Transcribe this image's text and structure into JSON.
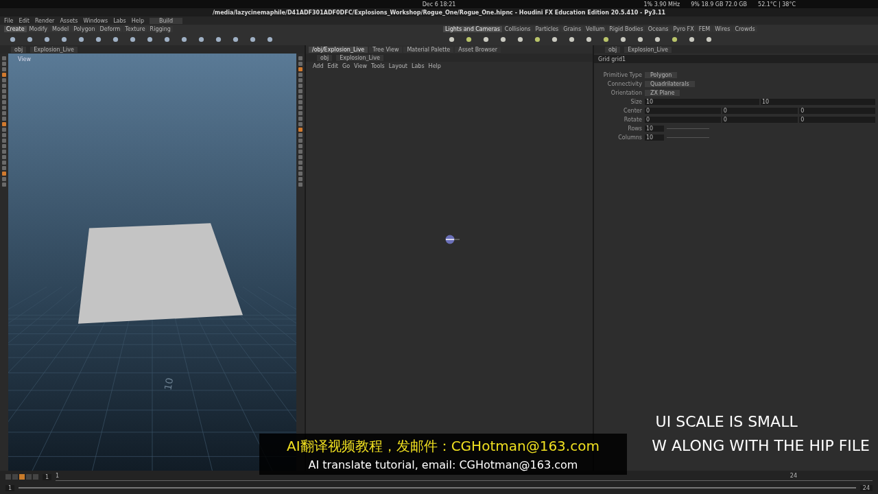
{
  "system_bar": {
    "clock": "Dec 6  18:21",
    "status": [
      "1%  3.90 MHz",
      "9%  18.9 GB  72.0 GB",
      "52.1°C | 38°C"
    ]
  },
  "window": {
    "title": "/media/lazycinemaphile/D41ADF301ADF0DFC/Explosions_Workshop/Rogue_One/Rogue_One.hipnc - Houdini FX Education Edition 20.5.410 - Py3.11"
  },
  "menu": [
    "File",
    "Edit",
    "Render",
    "Assets",
    "Windows",
    "Labs",
    "Help"
  ],
  "desk": "Build",
  "left_shelf": {
    "tabs": [
      {
        "label": "Create",
        "selected": true
      },
      {
        "label": "Modify",
        "selected": false
      },
      {
        "label": "Model",
        "selected": false
      },
      {
        "label": "Polygon",
        "selected": false
      },
      {
        "label": "Deform",
        "selected": false
      },
      {
        "label": "Texture",
        "selected": false
      },
      {
        "label": "Rigging",
        "selected": false
      }
    ]
  },
  "right_shelf": {
    "tabs": [
      {
        "label": "Lights and Cameras",
        "selected": true
      },
      {
        "label": "Collisions",
        "selected": false
      },
      {
        "label": "Particles",
        "selected": false
      },
      {
        "label": "Grains",
        "selected": false
      },
      {
        "label": "Vellum",
        "selected": false
      },
      {
        "label": "Rigid Bodies",
        "selected": false
      },
      {
        "label": "Oceans",
        "selected": false
      },
      {
        "label": "Pyro FX",
        "selected": false
      },
      {
        "label": "FEM",
        "selected": false
      },
      {
        "label": "Wires",
        "selected": false
      },
      {
        "label": "Crowds",
        "selected": false
      }
    ]
  },
  "viewport": {
    "path": [
      "obj",
      "Explosion_Live"
    ],
    "view_label": "View",
    "grid_label": "10"
  },
  "network": {
    "tabs": [
      {
        "label": "/obj/Explosion_Live",
        "selected": true
      },
      {
        "label": "Tree View",
        "selected": false
      },
      {
        "label": "Material Palette",
        "selected": false
      },
      {
        "label": "Asset Browser",
        "selected": false
      }
    ],
    "path": [
      "obj",
      "Explosion_Live"
    ],
    "menu": [
      "Add",
      "Edit",
      "Go",
      "View",
      "Tools",
      "Layout",
      "Labs",
      "Help"
    ]
  },
  "parameters": {
    "path": [
      "obj",
      "Explosion_Live"
    ],
    "node": "Grid  grid1",
    "menus": [
      {
        "label": "Primitive Type",
        "value": "Polygon"
      },
      {
        "label": "Connectivity",
        "value": "Quadrilaterals"
      },
      {
        "label": "Orientation",
        "value": "ZX Plane"
      }
    ],
    "vectors": [
      {
        "label": "Size",
        "values": [
          "10",
          "10"
        ]
      },
      {
        "label": "Center",
        "values": [
          "0",
          "0",
          "0"
        ]
      },
      {
        "label": "Rotate",
        "values": [
          "0",
          "0",
          "0"
        ]
      }
    ],
    "integers": [
      {
        "label": "Rows",
        "value": "10"
      },
      {
        "label": "Columns",
        "value": "10"
      }
    ]
  },
  "timeline": {
    "frame": "1",
    "start": "1",
    "end": "24",
    "ticks": [
      "1",
      "24"
    ]
  },
  "captions": [
    "UI SCALE IS SMALL",
    "W ALONG WITH THE HIP FILE"
  ],
  "subtitles": [
    "AI翻译视频教程，发邮件：CGHotman@163.com",
    "AI translate tutorial, email: CGHotman@163.com"
  ]
}
